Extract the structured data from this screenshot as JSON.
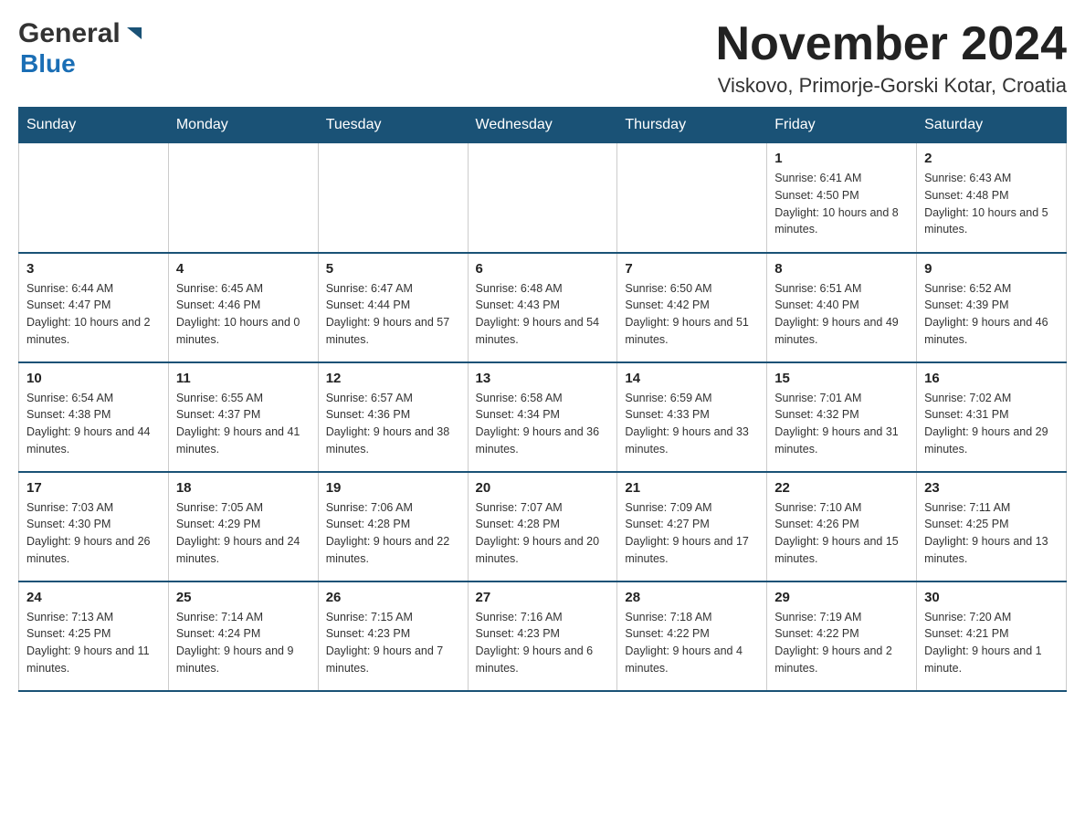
{
  "header": {
    "logo_general": "General",
    "logo_blue": "Blue",
    "month_title": "November 2024",
    "location": "Viskovo, Primorje-Gorski Kotar, Croatia"
  },
  "days_of_week": [
    "Sunday",
    "Monday",
    "Tuesday",
    "Wednesday",
    "Thursday",
    "Friday",
    "Saturday"
  ],
  "weeks": [
    {
      "days": [
        {
          "number": "",
          "info": ""
        },
        {
          "number": "",
          "info": ""
        },
        {
          "number": "",
          "info": ""
        },
        {
          "number": "",
          "info": ""
        },
        {
          "number": "",
          "info": ""
        },
        {
          "number": "1",
          "info": "Sunrise: 6:41 AM\nSunset: 4:50 PM\nDaylight: 10 hours and 8 minutes."
        },
        {
          "number": "2",
          "info": "Sunrise: 6:43 AM\nSunset: 4:48 PM\nDaylight: 10 hours and 5 minutes."
        }
      ]
    },
    {
      "days": [
        {
          "number": "3",
          "info": "Sunrise: 6:44 AM\nSunset: 4:47 PM\nDaylight: 10 hours and 2 minutes."
        },
        {
          "number": "4",
          "info": "Sunrise: 6:45 AM\nSunset: 4:46 PM\nDaylight: 10 hours and 0 minutes."
        },
        {
          "number": "5",
          "info": "Sunrise: 6:47 AM\nSunset: 4:44 PM\nDaylight: 9 hours and 57 minutes."
        },
        {
          "number": "6",
          "info": "Sunrise: 6:48 AM\nSunset: 4:43 PM\nDaylight: 9 hours and 54 minutes."
        },
        {
          "number": "7",
          "info": "Sunrise: 6:50 AM\nSunset: 4:42 PM\nDaylight: 9 hours and 51 minutes."
        },
        {
          "number": "8",
          "info": "Sunrise: 6:51 AM\nSunset: 4:40 PM\nDaylight: 9 hours and 49 minutes."
        },
        {
          "number": "9",
          "info": "Sunrise: 6:52 AM\nSunset: 4:39 PM\nDaylight: 9 hours and 46 minutes."
        }
      ]
    },
    {
      "days": [
        {
          "number": "10",
          "info": "Sunrise: 6:54 AM\nSunset: 4:38 PM\nDaylight: 9 hours and 44 minutes."
        },
        {
          "number": "11",
          "info": "Sunrise: 6:55 AM\nSunset: 4:37 PM\nDaylight: 9 hours and 41 minutes."
        },
        {
          "number": "12",
          "info": "Sunrise: 6:57 AM\nSunset: 4:36 PM\nDaylight: 9 hours and 38 minutes."
        },
        {
          "number": "13",
          "info": "Sunrise: 6:58 AM\nSunset: 4:34 PM\nDaylight: 9 hours and 36 minutes."
        },
        {
          "number": "14",
          "info": "Sunrise: 6:59 AM\nSunset: 4:33 PM\nDaylight: 9 hours and 33 minutes."
        },
        {
          "number": "15",
          "info": "Sunrise: 7:01 AM\nSunset: 4:32 PM\nDaylight: 9 hours and 31 minutes."
        },
        {
          "number": "16",
          "info": "Sunrise: 7:02 AM\nSunset: 4:31 PM\nDaylight: 9 hours and 29 minutes."
        }
      ]
    },
    {
      "days": [
        {
          "number": "17",
          "info": "Sunrise: 7:03 AM\nSunset: 4:30 PM\nDaylight: 9 hours and 26 minutes."
        },
        {
          "number": "18",
          "info": "Sunrise: 7:05 AM\nSunset: 4:29 PM\nDaylight: 9 hours and 24 minutes."
        },
        {
          "number": "19",
          "info": "Sunrise: 7:06 AM\nSunset: 4:28 PM\nDaylight: 9 hours and 22 minutes."
        },
        {
          "number": "20",
          "info": "Sunrise: 7:07 AM\nSunset: 4:28 PM\nDaylight: 9 hours and 20 minutes."
        },
        {
          "number": "21",
          "info": "Sunrise: 7:09 AM\nSunset: 4:27 PM\nDaylight: 9 hours and 17 minutes."
        },
        {
          "number": "22",
          "info": "Sunrise: 7:10 AM\nSunset: 4:26 PM\nDaylight: 9 hours and 15 minutes."
        },
        {
          "number": "23",
          "info": "Sunrise: 7:11 AM\nSunset: 4:25 PM\nDaylight: 9 hours and 13 minutes."
        }
      ]
    },
    {
      "days": [
        {
          "number": "24",
          "info": "Sunrise: 7:13 AM\nSunset: 4:25 PM\nDaylight: 9 hours and 11 minutes."
        },
        {
          "number": "25",
          "info": "Sunrise: 7:14 AM\nSunset: 4:24 PM\nDaylight: 9 hours and 9 minutes."
        },
        {
          "number": "26",
          "info": "Sunrise: 7:15 AM\nSunset: 4:23 PM\nDaylight: 9 hours and 7 minutes."
        },
        {
          "number": "27",
          "info": "Sunrise: 7:16 AM\nSunset: 4:23 PM\nDaylight: 9 hours and 6 minutes."
        },
        {
          "number": "28",
          "info": "Sunrise: 7:18 AM\nSunset: 4:22 PM\nDaylight: 9 hours and 4 minutes."
        },
        {
          "number": "29",
          "info": "Sunrise: 7:19 AM\nSunset: 4:22 PM\nDaylight: 9 hours and 2 minutes."
        },
        {
          "number": "30",
          "info": "Sunrise: 7:20 AM\nSunset: 4:21 PM\nDaylight: 9 hours and 1 minute."
        }
      ]
    }
  ]
}
